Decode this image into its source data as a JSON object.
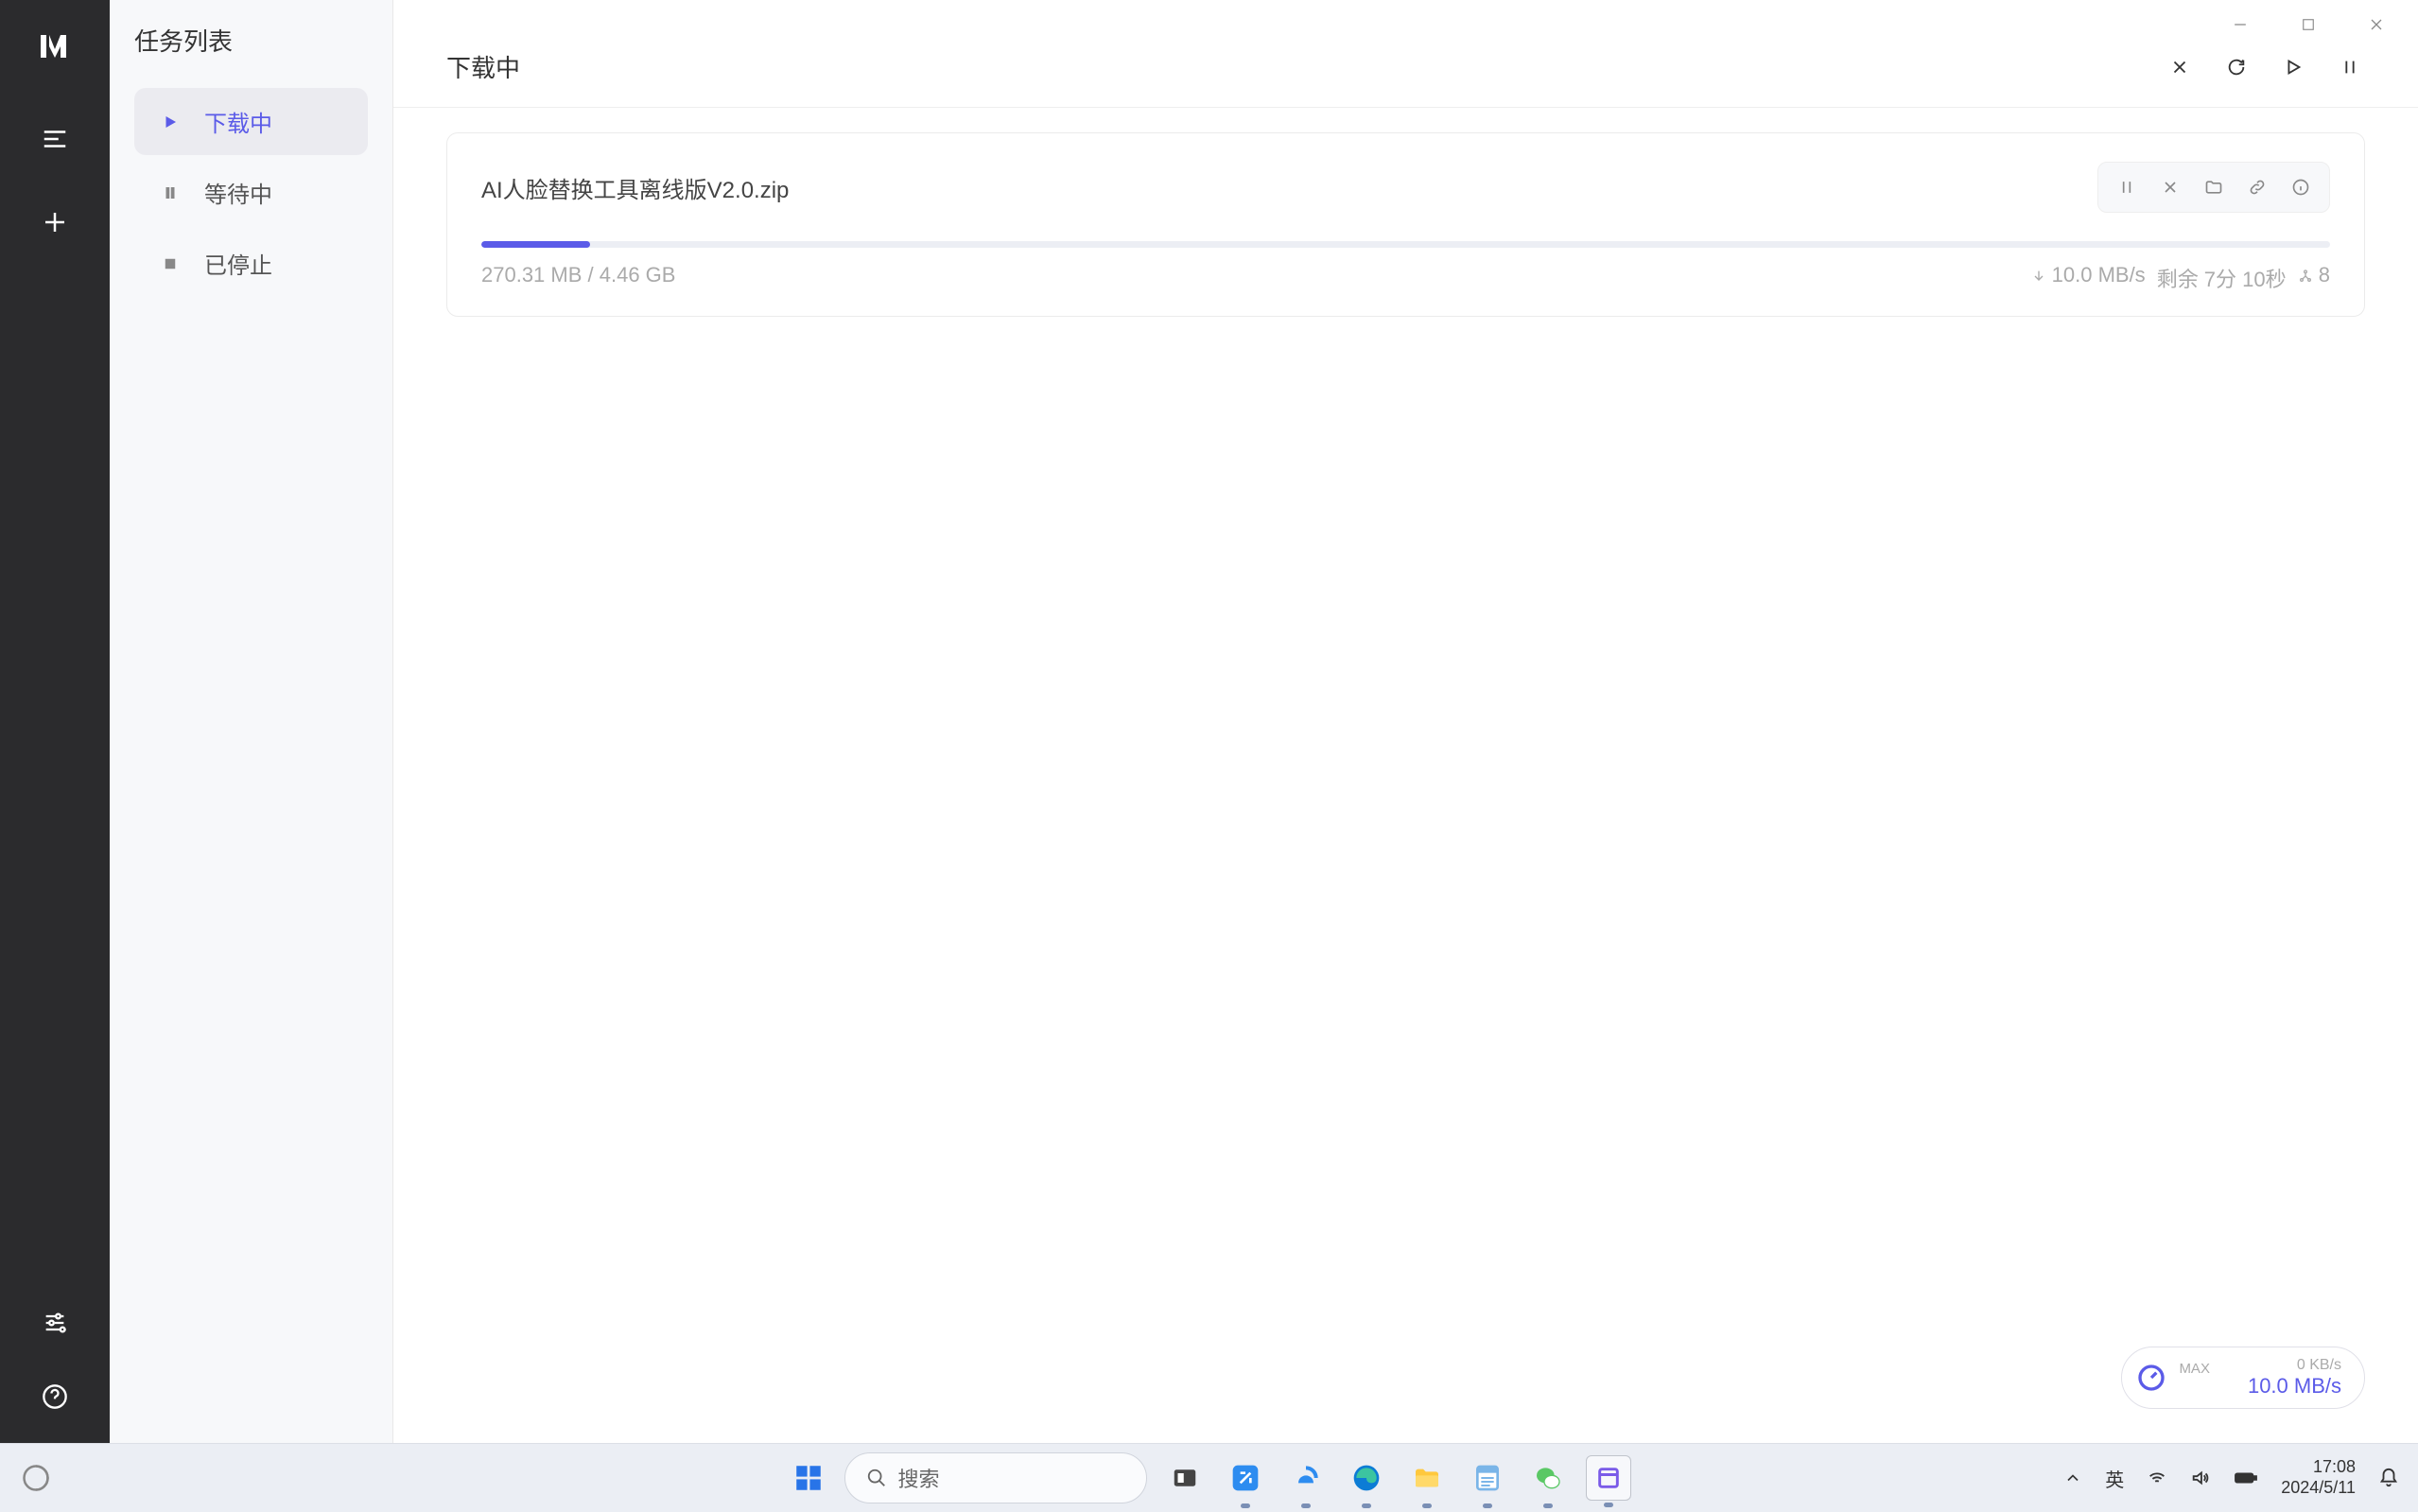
{
  "sidebar": {
    "title": "任务列表",
    "items": [
      {
        "label": "下载中"
      },
      {
        "label": "等待中"
      },
      {
        "label": "已停止"
      }
    ]
  },
  "main": {
    "title": "下载中"
  },
  "download": {
    "filename": "AI人脸替换工具离线版V2.0.zip",
    "size_text": "270.31 MB / 4.46 GB",
    "speed_text": "10.0 MB/s",
    "eta_text": "剩余 7分 10秒",
    "connections_text": "8",
    "progress_percent": 5.9
  },
  "speed_widget": {
    "max_label": "MAX",
    "up": "0 KB/s",
    "down": "10.0 MB/s"
  },
  "taskbar": {
    "search_placeholder": "搜索",
    "ime": "英",
    "time": "17:08",
    "date": "2024/5/11"
  }
}
